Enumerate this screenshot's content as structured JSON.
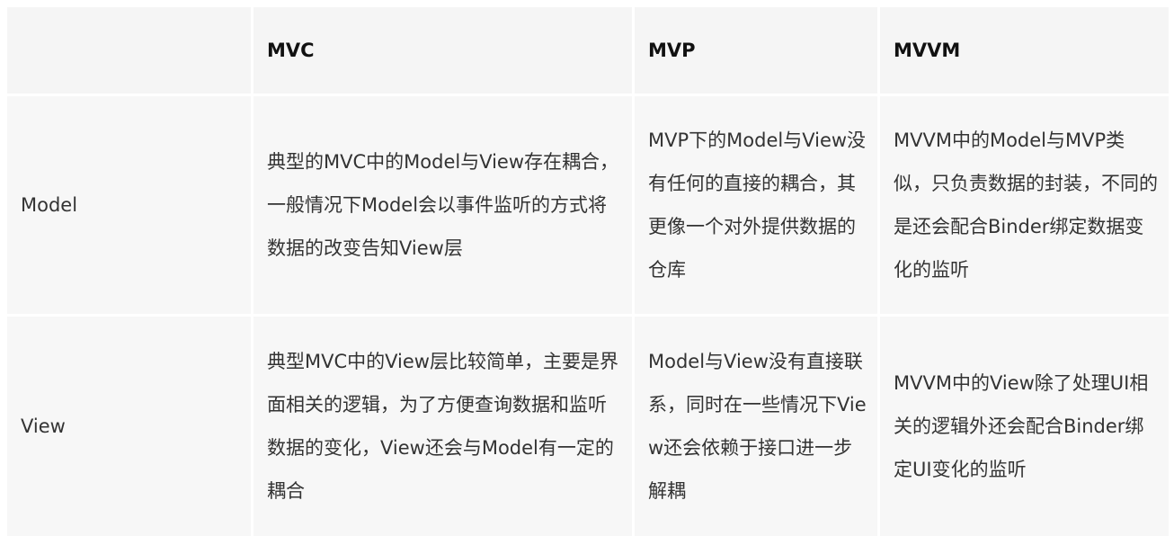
{
  "table": {
    "header": {
      "col0": "",
      "col1": "MVC",
      "col2": "MVP",
      "col3": "MVVM"
    },
    "rows": [
      {
        "label": "Model",
        "mvc": "典型的MVC中的Model与View存在耦合，一般情况下Model会以事件监听的方式将数据的改变告知View层",
        "mvp": "MVP下的Model与View没有任何的直接的耦合，其更像一个对外提供数据的仓库",
        "mvvm": "MVVM中的Model与MVP类似，只负责数据的封装，不同的是还会配合Binder绑定数据变化的监听"
      },
      {
        "label": "View",
        "mvc": "典型MVC中的View层比较简单，主要是界面相关的逻辑，为了方便查询数据和监听数据的变化，View还会与Model有一定的耦合",
        "mvp": "Model与View没有直接联系，同时在一些情况下View还会依赖于接口进一步解耦",
        "mvvm": "MVVM中的View除了处理UI相关的逻辑外还会配合Binder绑定UI变化的监听"
      }
    ]
  }
}
